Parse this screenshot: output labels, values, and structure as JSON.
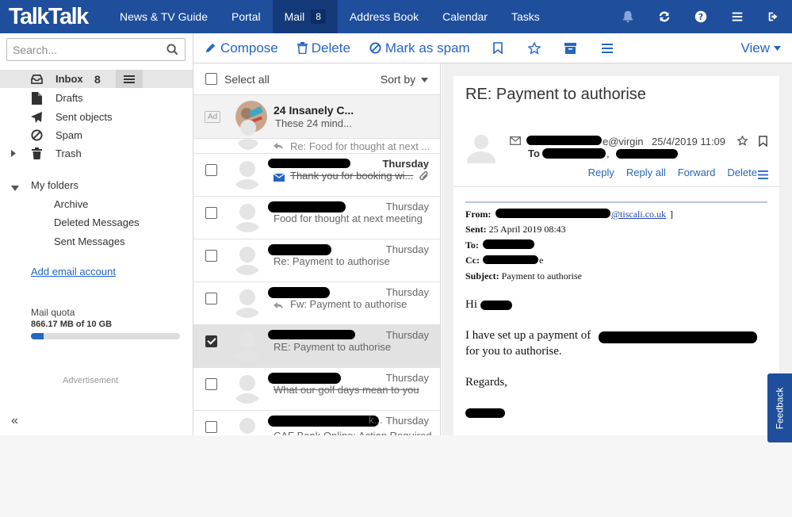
{
  "brand": {
    "logo": "TalkTalk"
  },
  "nav": {
    "items": [
      "News & TV Guide",
      "Portal",
      "Mail",
      "Address Book",
      "Calendar",
      "Tasks"
    ],
    "mail_badge": "8",
    "active": "Mail"
  },
  "top_icons": [
    "bell-icon",
    "refresh-icon",
    "help-icon",
    "menu-icon",
    "logout-icon"
  ],
  "search": {
    "placeholder": "Search..."
  },
  "folders": {
    "inbox": {
      "label": "Inbox",
      "count": "8"
    },
    "drafts": "Drafts",
    "sent": "Sent objects",
    "spam": "Spam",
    "trash": "Trash",
    "my_folders": "My folders",
    "sub": [
      "Archive",
      "Deleted Messages",
      "Sent Messages"
    ]
  },
  "add_account": "Add email account",
  "quota": {
    "label": "Mail quota",
    "value": "866.17 MB of 10 GB",
    "fraction": 0.085
  },
  "advertisement": "Advertisement",
  "collapse_glyph": "«",
  "toolbar": {
    "compose": "Compose",
    "delete": "Delete",
    "spam": "Mark as spam",
    "view": "View"
  },
  "list": {
    "select_all": "Select all",
    "sort_by": "Sort by",
    "ad": {
      "badge": "Ad",
      "sender": "24 Insanely C...",
      "subject": "These 24 mind..."
    },
    "partial_subject": "Re: Food for thought at next ...",
    "rows": [
      {
        "date": "Thursday",
        "subject": "Thank you for booking wi...",
        "unread": true,
        "checked": false
      },
      {
        "date": "Thursday",
        "subject": "Food for thought at next meeting",
        "unread": false,
        "checked": false
      },
      {
        "date": "Thursday",
        "subject": "Re: Payment to authorise",
        "unread": false,
        "checked": false
      },
      {
        "date": "Thursday",
        "subject": "Fw: Payment to authorise",
        "unread": false,
        "checked": false
      },
      {
        "date": "Thursday",
        "subject": "RE: Payment to authorise",
        "unread": false,
        "checked": true
      },
      {
        "date": "Thursday",
        "subject": "What our golf days mean to you",
        "unread": false,
        "checked": false
      },
      {
        "date": "Thursday",
        "subject": "CAF Bank Online: Action Required",
        "unread": false,
        "checked": false
      }
    ],
    "row8_sender_suffix": "k..."
  },
  "message": {
    "title": "RE: Payment to authorise",
    "from_suffix": "e@virgin",
    "to_label": "To",
    "date": "25/4/2019 11:09",
    "actions": [
      "Reply",
      "Reply all",
      "Forward",
      "Delete"
    ],
    "headers": {
      "from_label": "From:",
      "from_suffix": "@tiscali.co.uk",
      "sent_label": "Sent:",
      "sent_value": "25 April 2019 08:43",
      "to_label": "To:",
      "cc_label": "Cc:",
      "cc_suffix": "e",
      "subject_label": "Subject:",
      "subject_value": "Payment to authorise"
    },
    "body": {
      "greeting": "Hi",
      "line1": "I have set up a payment of",
      "line2": "for you to authorise.",
      "signoff": "Regards,"
    }
  },
  "feedback": "Feedback"
}
